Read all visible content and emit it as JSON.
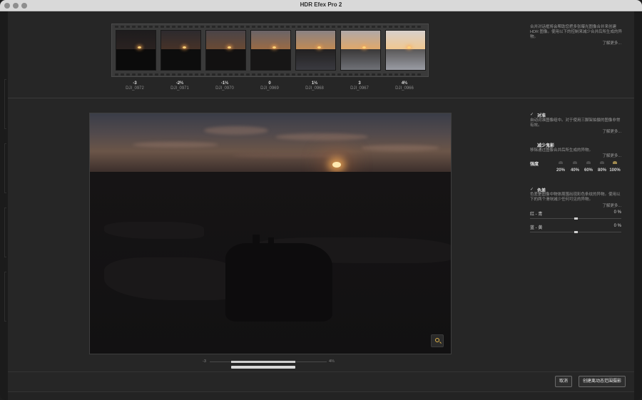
{
  "window": {
    "title": "HDR Efex Pro 2"
  },
  "exposures": [
    {
      "ev": "-3",
      "name": "DJI_0972"
    },
    {
      "ev": "-2⅔",
      "name": "DJI_0971"
    },
    {
      "ev": "-1⅓",
      "name": "DJI_0970"
    },
    {
      "ev": "0",
      "name": "DJI_0969"
    },
    {
      "ev": "1⅓",
      "name": "DJI_0968"
    },
    {
      "ev": "3",
      "name": "DJI_0967"
    },
    {
      "ev": "4⅔",
      "name": "DJI_0966"
    }
  ],
  "intro": {
    "text": "合并对话框将会帮助您把多张曝光图像合并来创建 HDR 图像。使用以下的控制来减少合并后所生成的异物。",
    "learn_more": "了解更多..."
  },
  "alignment": {
    "checked": "✓",
    "title": "对准",
    "desc": "自动对准图像组中。对于使用三脚架拍摄的图像非常有效。",
    "learn_more": "了解更多..."
  },
  "ghost": {
    "checked": "",
    "title": "减少鬼影",
    "desc": "移除通过图像合并后所生成的异物。",
    "learn_more": "了解更多...",
    "strength_label": "强度",
    "levels": [
      "20%",
      "40%",
      "60%",
      "80%",
      "100%"
    ],
    "selected_index": 4
  },
  "chromatic": {
    "checked": "✓",
    "title": "色差",
    "desc": "色差是图像中物体周围出现彩色条纹的异物。使用以下的两个滑块减少任何可见的异物。",
    "learn_more": "了解更多...",
    "red_cyan": {
      "label": "红 - 青",
      "value": "0 %",
      "fraction": 0.5
    },
    "blue_yellow": {
      "label": "蓝 - 黄",
      "value": "0 %",
      "fraction": 0.5
    }
  },
  "exposure_range": {
    "min": "-3",
    "max": "4⅔"
  },
  "buttons": {
    "cancel": "取消",
    "create": "创建离动态范围摄影"
  }
}
